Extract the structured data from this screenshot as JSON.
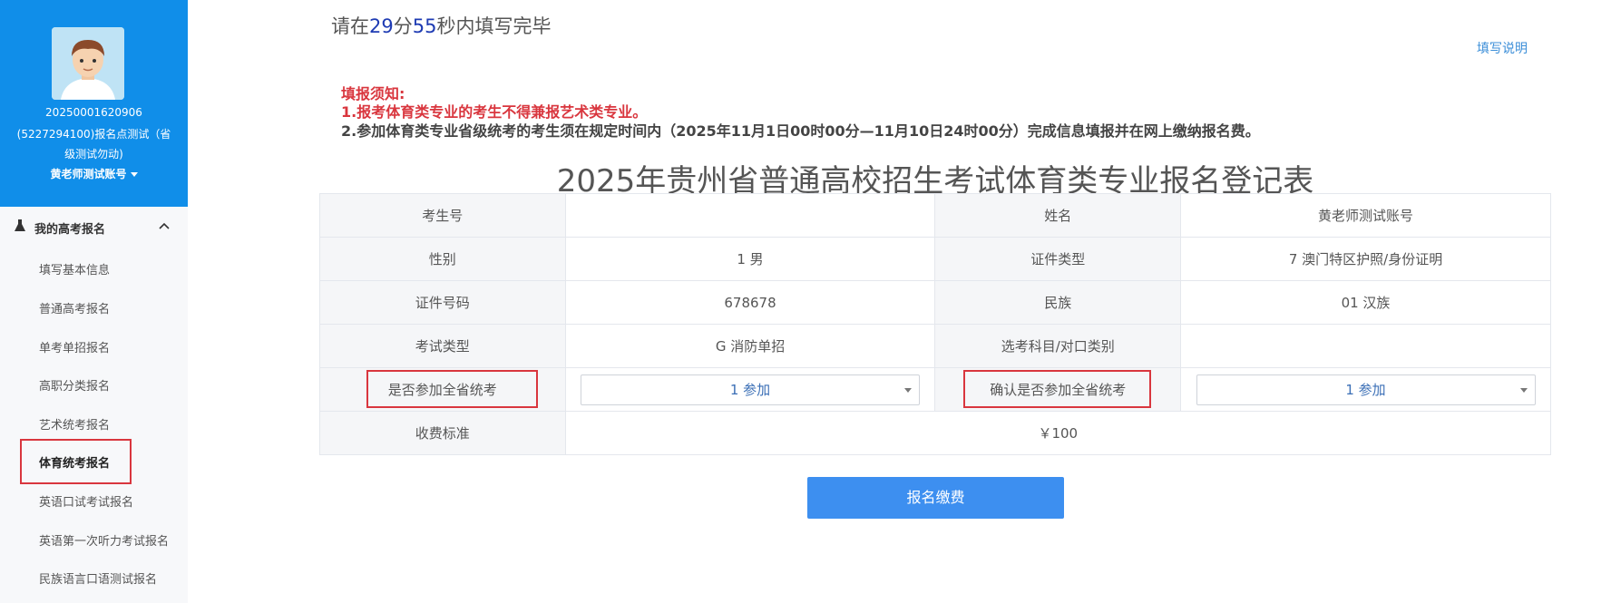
{
  "sidebar": {
    "profile": {
      "id_line": "20250001620906",
      "org_line1": "(5227294100)报名点测试（省",
      "org_line2": "级测试勿动)",
      "account": "黄老师测试账号"
    },
    "menu_header": "我的高考报名",
    "items": [
      {
        "label": "填写基本信息"
      },
      {
        "label": "普通高考报名"
      },
      {
        "label": "单考单招报名"
      },
      {
        "label": "高职分类报名"
      },
      {
        "label": "艺术统考报名"
      },
      {
        "label": "体育统考报名"
      },
      {
        "label": "英语口试考试报名"
      },
      {
        "label": "英语第一次听力考试报名"
      },
      {
        "label": "民族语言口语测试报名"
      }
    ],
    "active_index": 5
  },
  "timer": {
    "prefix": "请在",
    "minutes": "29",
    "min_unit": "分",
    "seconds": "55",
    "suffix": "秒内填写完毕"
  },
  "help_link": "填写说明",
  "notice": {
    "title": "填报须知:",
    "line1": "1.报考体育类专业的考生不得兼报艺术类专业。",
    "line2": "2.参加体育类专业省级统考的考生须在规定时间内（2025年11月1日00时00分—11月10日24时00分）完成信息填报并在网上缴纳报名费。"
  },
  "form": {
    "title": "2025年贵州省普通高校招生考试体育类专业报名登记表",
    "rows": [
      {
        "l1": "考生号",
        "v1": "",
        "l2": "姓名",
        "v2": "黄老师测试账号"
      },
      {
        "l1": "性别",
        "v1": "1 男",
        "l2": "证件类型",
        "v2": "7 澳门特区护照/身份证明"
      },
      {
        "l1": "证件号码",
        "v1": "678678",
        "l2": "民族",
        "v2": "01 汉族"
      },
      {
        "l1": "考试类型",
        "v1": "G 消防单招",
        "l2": "选考科目/对口类别",
        "v2": ""
      }
    ],
    "select_row": {
      "l1": "是否参加全省统考",
      "s1": "1 参加",
      "l2": "确认是否参加全省统考",
      "s2": "1 参加"
    },
    "fee_row": {
      "label": "收费标准",
      "value": "￥100"
    }
  },
  "submit_label": "报名缴费",
  "colors": {
    "profile_bg": "#108ee9",
    "accent_red": "#d9363e",
    "button_blue": "#3d8ff0",
    "timer_number": "#1e3bb3"
  }
}
